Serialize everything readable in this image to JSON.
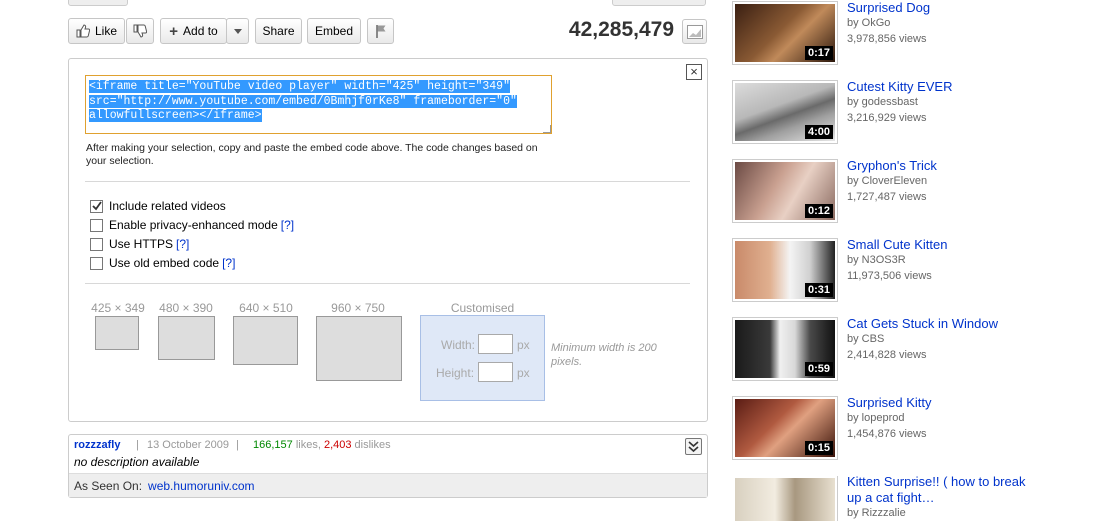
{
  "actions": {
    "like_label": "Like",
    "add_to_label": "Add to",
    "share_label": "Share",
    "embed_label": "Embed",
    "view_count": "42,285,479"
  },
  "embed": {
    "code_line1": "<iframe title=\"YouTube video player\" width=\"425\" height=\"349\"",
    "code_line2": "src=\"http://www.youtube.com/embed/0Bmhjf0rKe8\" frameborder=\"0\"",
    "code_line3": "allowfullscreen></iframe>",
    "hint": "After making your selection, copy and paste the embed code above. The code changes based on your selection.",
    "options": [
      {
        "label": "Include related videos",
        "checked": true,
        "help": ""
      },
      {
        "label": "Enable privacy-enhanced mode",
        "checked": false,
        "help": "[?]"
      },
      {
        "label": "Use HTTPS",
        "checked": false,
        "help": "[?]"
      },
      {
        "label": "Use old embed code",
        "checked": false,
        "help": "[?]"
      }
    ],
    "sizes": [
      "425 × 349",
      "480 × 390",
      "640 × 510",
      "960 × 750"
    ],
    "custom_label": "Customised",
    "width_label": "Width:",
    "height_label": "Height:",
    "unit": "px",
    "min_width_note": "Minimum width is 200 pixels."
  },
  "description": {
    "uploader": "rozzzafly",
    "sep": "|",
    "date": "13 October 2009",
    "likes": "166,157",
    "likes_word": "likes,",
    "dislikes": "2,403",
    "dislikes_word": "dislikes",
    "text": "no description available",
    "seen_on_label": "As Seen On:",
    "seen_on_link": "web.humoruniv.com"
  },
  "related": [
    {
      "title": "Surprised Dog",
      "by": "by OkGo",
      "views": "3,978,856 views",
      "duration": "0:17"
    },
    {
      "title": "Cutest Kitty EVER",
      "by": "by godessbast",
      "views": "3,216,929 views",
      "duration": "4:00"
    },
    {
      "title": "Gryphon's Trick",
      "by": "by CloverEleven",
      "views": "1,727,487 views",
      "duration": "0:12"
    },
    {
      "title": "Small Cute Kitten",
      "by": "by N3OS3R",
      "views": "11,973,506 views",
      "duration": "0:31"
    },
    {
      "title": "Cat Gets Stuck in Window",
      "by": "by CBS",
      "views": "2,414,828 views",
      "duration": "0:59"
    },
    {
      "title": "Surprised Kitty",
      "by": "by lopeprod",
      "views": "1,454,876 views",
      "duration": "0:15"
    },
    {
      "title": "Kitten Surprise!! ( how to break up a cat fight…",
      "by": "by Rizzzalie",
      "views": "",
      "duration": ""
    }
  ],
  "colors": {
    "link": "#0033cc",
    "selection": "#3399ff",
    "embed_border": "#e0a12f"
  }
}
